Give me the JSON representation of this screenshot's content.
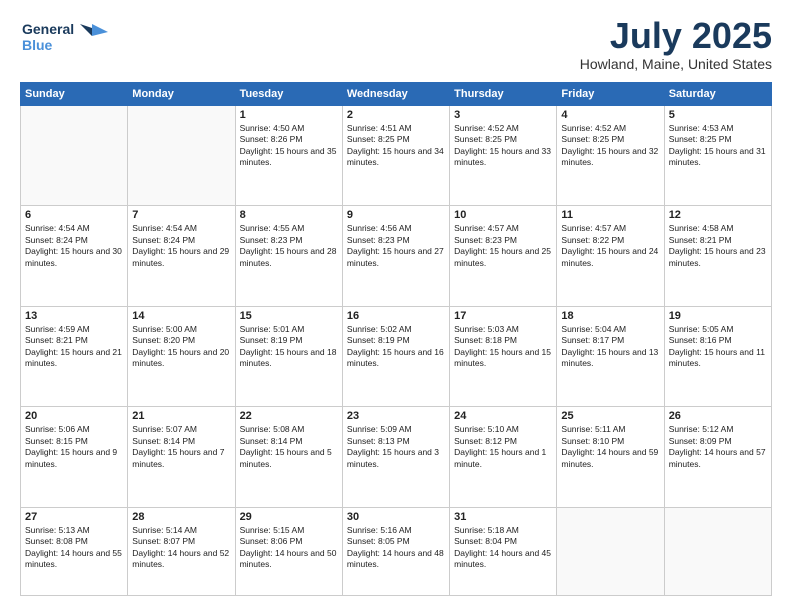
{
  "logo": {
    "line1": "General",
    "line2": "Blue"
  },
  "title": "July 2025",
  "location": "Howland, Maine, United States",
  "days_of_week": [
    "Sunday",
    "Monday",
    "Tuesday",
    "Wednesday",
    "Thursday",
    "Friday",
    "Saturday"
  ],
  "weeks": [
    [
      {
        "day": null
      },
      {
        "day": null
      },
      {
        "day": "1",
        "sunrise": "Sunrise: 4:50 AM",
        "sunset": "Sunset: 8:26 PM",
        "daylight": "Daylight: 15 hours and 35 minutes."
      },
      {
        "day": "2",
        "sunrise": "Sunrise: 4:51 AM",
        "sunset": "Sunset: 8:25 PM",
        "daylight": "Daylight: 15 hours and 34 minutes."
      },
      {
        "day": "3",
        "sunrise": "Sunrise: 4:52 AM",
        "sunset": "Sunset: 8:25 PM",
        "daylight": "Daylight: 15 hours and 33 minutes."
      },
      {
        "day": "4",
        "sunrise": "Sunrise: 4:52 AM",
        "sunset": "Sunset: 8:25 PM",
        "daylight": "Daylight: 15 hours and 32 minutes."
      },
      {
        "day": "5",
        "sunrise": "Sunrise: 4:53 AM",
        "sunset": "Sunset: 8:25 PM",
        "daylight": "Daylight: 15 hours and 31 minutes."
      }
    ],
    [
      {
        "day": "6",
        "sunrise": "Sunrise: 4:54 AM",
        "sunset": "Sunset: 8:24 PM",
        "daylight": "Daylight: 15 hours and 30 minutes."
      },
      {
        "day": "7",
        "sunrise": "Sunrise: 4:54 AM",
        "sunset": "Sunset: 8:24 PM",
        "daylight": "Daylight: 15 hours and 29 minutes."
      },
      {
        "day": "8",
        "sunrise": "Sunrise: 4:55 AM",
        "sunset": "Sunset: 8:23 PM",
        "daylight": "Daylight: 15 hours and 28 minutes."
      },
      {
        "day": "9",
        "sunrise": "Sunrise: 4:56 AM",
        "sunset": "Sunset: 8:23 PM",
        "daylight": "Daylight: 15 hours and 27 minutes."
      },
      {
        "day": "10",
        "sunrise": "Sunrise: 4:57 AM",
        "sunset": "Sunset: 8:23 PM",
        "daylight": "Daylight: 15 hours and 25 minutes."
      },
      {
        "day": "11",
        "sunrise": "Sunrise: 4:57 AM",
        "sunset": "Sunset: 8:22 PM",
        "daylight": "Daylight: 15 hours and 24 minutes."
      },
      {
        "day": "12",
        "sunrise": "Sunrise: 4:58 AM",
        "sunset": "Sunset: 8:21 PM",
        "daylight": "Daylight: 15 hours and 23 minutes."
      }
    ],
    [
      {
        "day": "13",
        "sunrise": "Sunrise: 4:59 AM",
        "sunset": "Sunset: 8:21 PM",
        "daylight": "Daylight: 15 hours and 21 minutes."
      },
      {
        "day": "14",
        "sunrise": "Sunrise: 5:00 AM",
        "sunset": "Sunset: 8:20 PM",
        "daylight": "Daylight: 15 hours and 20 minutes."
      },
      {
        "day": "15",
        "sunrise": "Sunrise: 5:01 AM",
        "sunset": "Sunset: 8:19 PM",
        "daylight": "Daylight: 15 hours and 18 minutes."
      },
      {
        "day": "16",
        "sunrise": "Sunrise: 5:02 AM",
        "sunset": "Sunset: 8:19 PM",
        "daylight": "Daylight: 15 hours and 16 minutes."
      },
      {
        "day": "17",
        "sunrise": "Sunrise: 5:03 AM",
        "sunset": "Sunset: 8:18 PM",
        "daylight": "Daylight: 15 hours and 15 minutes."
      },
      {
        "day": "18",
        "sunrise": "Sunrise: 5:04 AM",
        "sunset": "Sunset: 8:17 PM",
        "daylight": "Daylight: 15 hours and 13 minutes."
      },
      {
        "day": "19",
        "sunrise": "Sunrise: 5:05 AM",
        "sunset": "Sunset: 8:16 PM",
        "daylight": "Daylight: 15 hours and 11 minutes."
      }
    ],
    [
      {
        "day": "20",
        "sunrise": "Sunrise: 5:06 AM",
        "sunset": "Sunset: 8:15 PM",
        "daylight": "Daylight: 15 hours and 9 minutes."
      },
      {
        "day": "21",
        "sunrise": "Sunrise: 5:07 AM",
        "sunset": "Sunset: 8:14 PM",
        "daylight": "Daylight: 15 hours and 7 minutes."
      },
      {
        "day": "22",
        "sunrise": "Sunrise: 5:08 AM",
        "sunset": "Sunset: 8:14 PM",
        "daylight": "Daylight: 15 hours and 5 minutes."
      },
      {
        "day": "23",
        "sunrise": "Sunrise: 5:09 AM",
        "sunset": "Sunset: 8:13 PM",
        "daylight": "Daylight: 15 hours and 3 minutes."
      },
      {
        "day": "24",
        "sunrise": "Sunrise: 5:10 AM",
        "sunset": "Sunset: 8:12 PM",
        "daylight": "Daylight: 15 hours and 1 minute."
      },
      {
        "day": "25",
        "sunrise": "Sunrise: 5:11 AM",
        "sunset": "Sunset: 8:10 PM",
        "daylight": "Daylight: 14 hours and 59 minutes."
      },
      {
        "day": "26",
        "sunrise": "Sunrise: 5:12 AM",
        "sunset": "Sunset: 8:09 PM",
        "daylight": "Daylight: 14 hours and 57 minutes."
      }
    ],
    [
      {
        "day": "27",
        "sunrise": "Sunrise: 5:13 AM",
        "sunset": "Sunset: 8:08 PM",
        "daylight": "Daylight: 14 hours and 55 minutes."
      },
      {
        "day": "28",
        "sunrise": "Sunrise: 5:14 AM",
        "sunset": "Sunset: 8:07 PM",
        "daylight": "Daylight: 14 hours and 52 minutes."
      },
      {
        "day": "29",
        "sunrise": "Sunrise: 5:15 AM",
        "sunset": "Sunset: 8:06 PM",
        "daylight": "Daylight: 14 hours and 50 minutes."
      },
      {
        "day": "30",
        "sunrise": "Sunrise: 5:16 AM",
        "sunset": "Sunset: 8:05 PM",
        "daylight": "Daylight: 14 hours and 48 minutes."
      },
      {
        "day": "31",
        "sunrise": "Sunrise: 5:18 AM",
        "sunset": "Sunset: 8:04 PM",
        "daylight": "Daylight: 14 hours and 45 minutes."
      },
      {
        "day": null
      },
      {
        "day": null
      }
    ]
  ]
}
